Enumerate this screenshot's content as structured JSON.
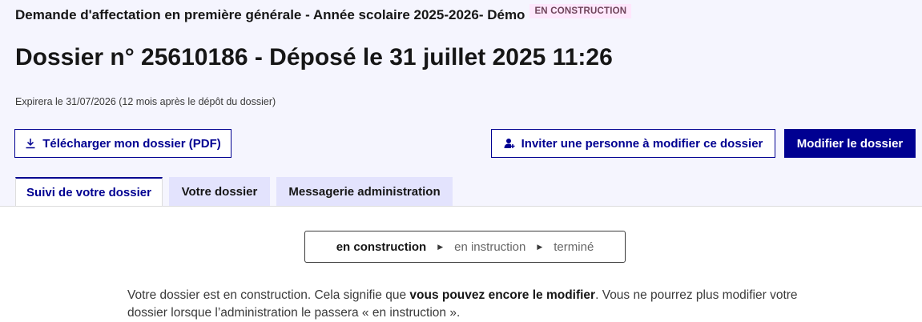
{
  "header": {
    "procedure_title": "Demande d'affectation en première générale - Année scolaire 2025-2026- Démo",
    "state_badge": "EN CONSTRUCTION",
    "dossier_title": "Dossier n° 25610186 - Déposé le 31 juillet 2025 11:26",
    "expiry_text": "Expirera le 31/07/2026 (12 mois après le dépôt du dossier)"
  },
  "actions": {
    "download_label": "Télécharger mon dossier (PDF)",
    "invite_label": "Inviter une personne à modifier ce dossier",
    "edit_label": "Modifier le dossier"
  },
  "tabs": [
    {
      "label": "Suivi de votre dossier",
      "active": true
    },
    {
      "label": "Votre dossier",
      "active": false
    },
    {
      "label": "Messagerie administration",
      "active": false
    }
  ],
  "status_steps": [
    {
      "label": "en construction",
      "current": true
    },
    {
      "label": "en instruction",
      "current": false
    },
    {
      "label": "terminé",
      "current": false
    }
  ],
  "explanation": {
    "part1": "Votre dossier est en construction. Cela signifie que ",
    "bold": "vous pouvez encore le modifier",
    "part2": ". Vous ne pourrez plus modifier votre dossier lorsque l’administration le passera « en instruction »."
  },
  "colors": {
    "primary": "#000091",
    "header_bg": "#f5f5fe",
    "tab_bg": "#e3e3fd",
    "badge_bg": "#fee7fc",
    "badge_text": "#6e445a"
  },
  "icons": {
    "download": "download-icon",
    "invite": "user-add-icon",
    "step_separator": "triangle-right-icon"
  }
}
